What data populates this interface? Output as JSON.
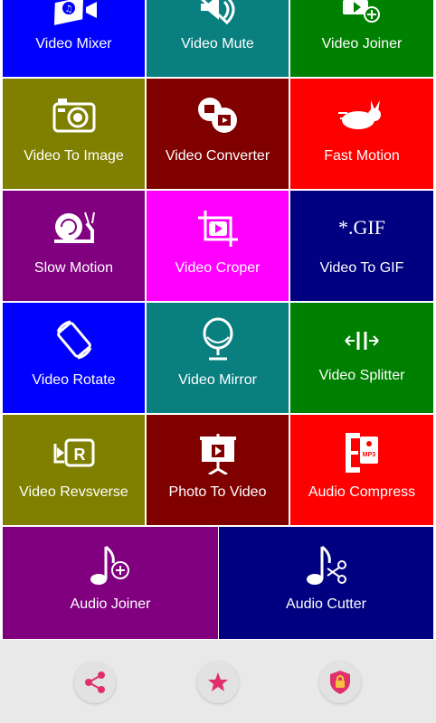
{
  "tiles": [
    {
      "label": "Video Mixer",
      "color": "#0000ff",
      "icon": "video-music-icon"
    },
    {
      "label": "Video Mute",
      "color": "#0a7f80",
      "icon": "mute-speaker-icon"
    },
    {
      "label": "Video Joiner",
      "color": "#008000",
      "icon": "video-add-icon"
    },
    {
      "label": "Video To Image",
      "color": "#808000",
      "icon": "camera-icon"
    },
    {
      "label": "Video Converter",
      "color": "#800000",
      "icon": "convert-video-icon"
    },
    {
      "label": "Fast Motion",
      "color": "#ff0000",
      "icon": "rabbit-icon"
    },
    {
      "label": "Slow Motion",
      "color": "#800080",
      "icon": "snail-icon"
    },
    {
      "label": "Video Croper",
      "color": "#ff00ff",
      "icon": "crop-video-icon"
    },
    {
      "label": "Video To GIF",
      "color": "#000080",
      "icon": "gif-icon",
      "icon_text": "*.GIF"
    },
    {
      "label": "Video Rotate",
      "color": "#0000ff",
      "icon": "rotate-icon"
    },
    {
      "label": "Video Mirror",
      "color": "#0a7f80",
      "icon": "mirror-icon"
    },
    {
      "label": "Video Splitter",
      "color": "#008000",
      "icon": "split-icon"
    },
    {
      "label": "Video Revsverse",
      "color": "#808000",
      "icon": "reverse-icon",
      "icon_text": "R"
    },
    {
      "label": "Photo To Video",
      "color": "#800000",
      "icon": "presentation-icon"
    },
    {
      "label": "Audio Compress",
      "color": "#ff0000",
      "icon": "compress-icon",
      "icon_text": "MP3"
    },
    {
      "label": "Audio Joiner",
      "color": "#800080",
      "icon": "music-add-icon"
    },
    {
      "label": "Audio Cutter",
      "color": "#000080",
      "icon": "music-cut-icon"
    }
  ],
  "bottom_bar": {
    "background": "#e9e9e9",
    "buttons": [
      {
        "icon": "share-icon",
        "color": "#e0306a"
      },
      {
        "icon": "star-icon",
        "color": "#e0306a"
      },
      {
        "icon": "shield-lock-icon",
        "color": "#e0306a"
      }
    ]
  }
}
